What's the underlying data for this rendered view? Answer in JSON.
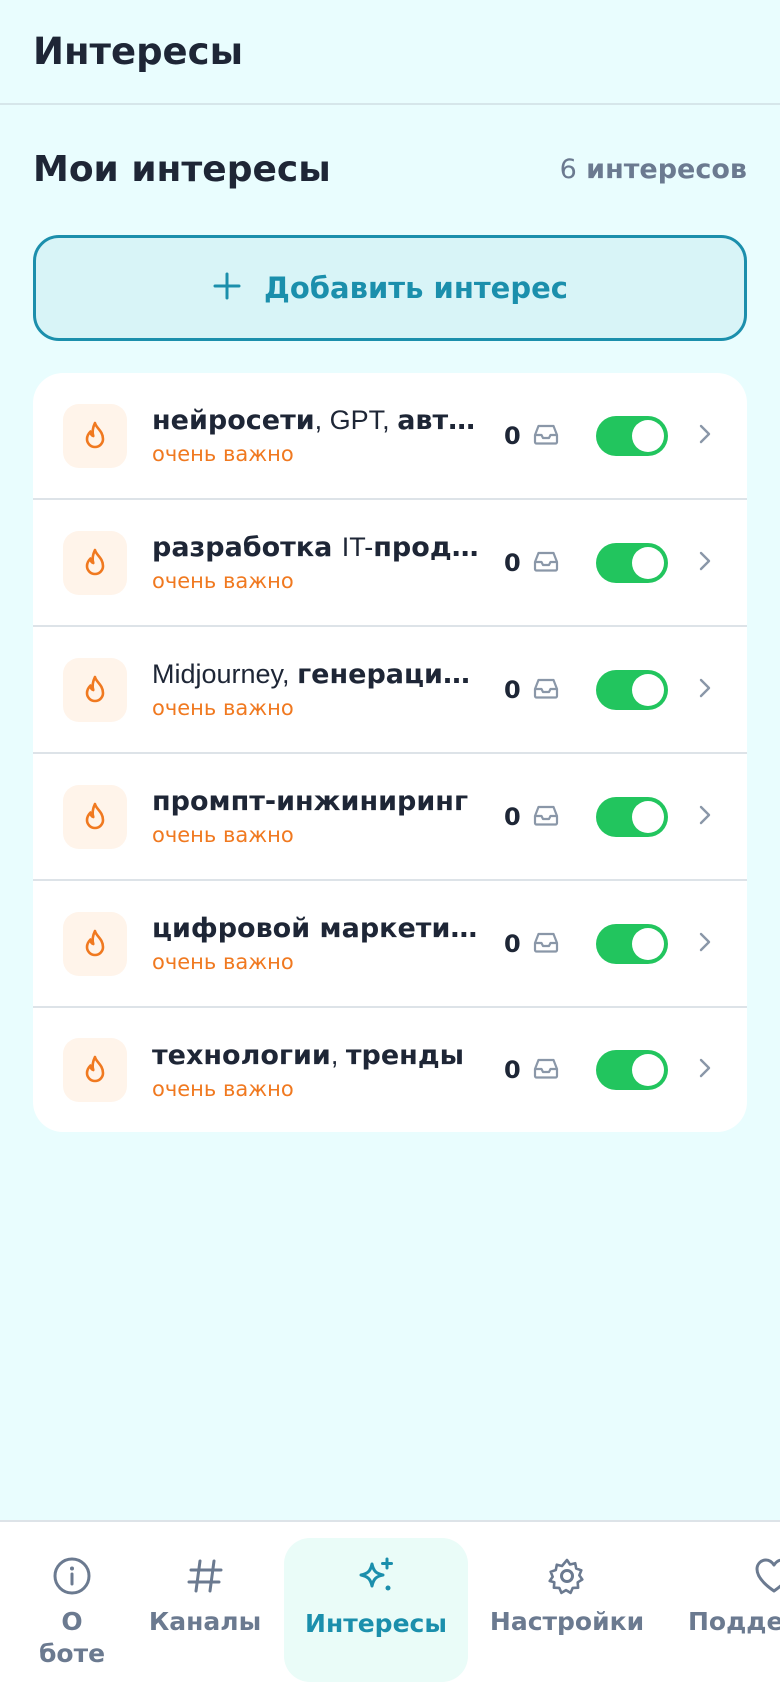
{
  "header": {
    "title": "Интересы"
  },
  "section": {
    "title": "Мои интересы",
    "count_num": "6",
    "count_label": "интересов"
  },
  "add_button": {
    "label": "Добавить интерес"
  },
  "interests": [
    {
      "title_html": "<b>нейросети</b><span class=\"plain\">, GPT, </span><b>автоматизация</b>",
      "priority": "очень важно",
      "count": "0"
    },
    {
      "title_html": "<b>разработка </b><span class=\"plain\">IT-</span><b>продуктов</b>",
      "priority": "очень важно",
      "count": "0"
    },
    {
      "title_html": "<span class=\"plain\">Midjourney, </span><b>генерация изображений</b>",
      "priority": "очень важно",
      "count": "0"
    },
    {
      "title_html": "<b>промпт-инжиниринг</b>",
      "priority": "очень важно",
      "count": "0"
    },
    {
      "title_html": "<b>цифровой маркетинг</b>",
      "priority": "очень важно",
      "count": "0"
    },
    {
      "title_html": "<b>технологии</b><span class=\"plain\">, </span><b>тренды</b>",
      "priority": "очень важно",
      "count": "0"
    }
  ],
  "nav": {
    "about_line1": "О",
    "about_line2": "боте",
    "channels": "Каналы",
    "interests": "Интересы",
    "settings": "Настройки",
    "support": "Поддержка"
  },
  "colors": {
    "accent": "#1b8fac",
    "toggle_on": "#22c55e",
    "priority": "#f07920"
  }
}
